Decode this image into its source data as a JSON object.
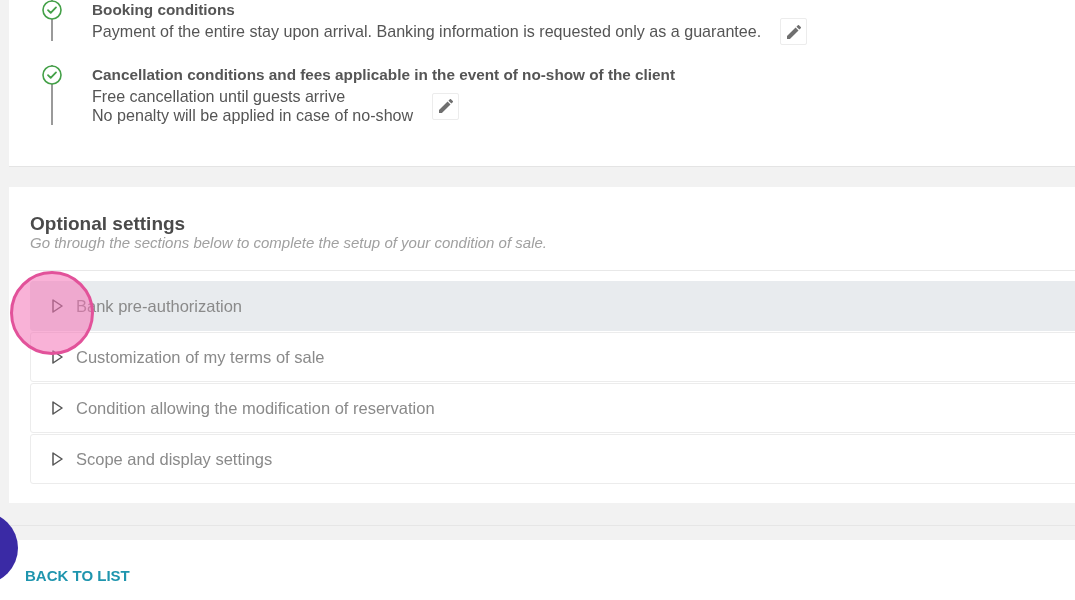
{
  "conditions": [
    {
      "title": "Booking conditions",
      "done": true,
      "lines": [
        "Payment of the entire stay upon arrival. Banking information is requested only as a guarantee."
      ],
      "editable": true
    },
    {
      "title": "Cancellation conditions and fees applicable in the event of no-show of the client",
      "done": true,
      "lines": [
        "Free cancellation until guests arrive",
        "No penalty will be applied in case of no-show"
      ],
      "editable": true
    }
  ],
  "optional_settings": {
    "title": "Optional settings",
    "subtitle": "Go through the sections below to complete the setup of your condition of sale.",
    "sections": [
      {
        "label": "Bank pre-authorization",
        "selected": true,
        "expanded": false
      },
      {
        "label": "Customization of my terms of sale",
        "selected": false,
        "expanded": false
      },
      {
        "label": "Condition allowing the modification of reservation",
        "selected": false,
        "expanded": false
      },
      {
        "label": "Scope and display settings",
        "selected": false,
        "expanded": false
      }
    ]
  },
  "footer": {
    "back_link": "BACK TO LIST"
  },
  "overlays": {
    "touch_indicator": true,
    "floating_button": true
  }
}
